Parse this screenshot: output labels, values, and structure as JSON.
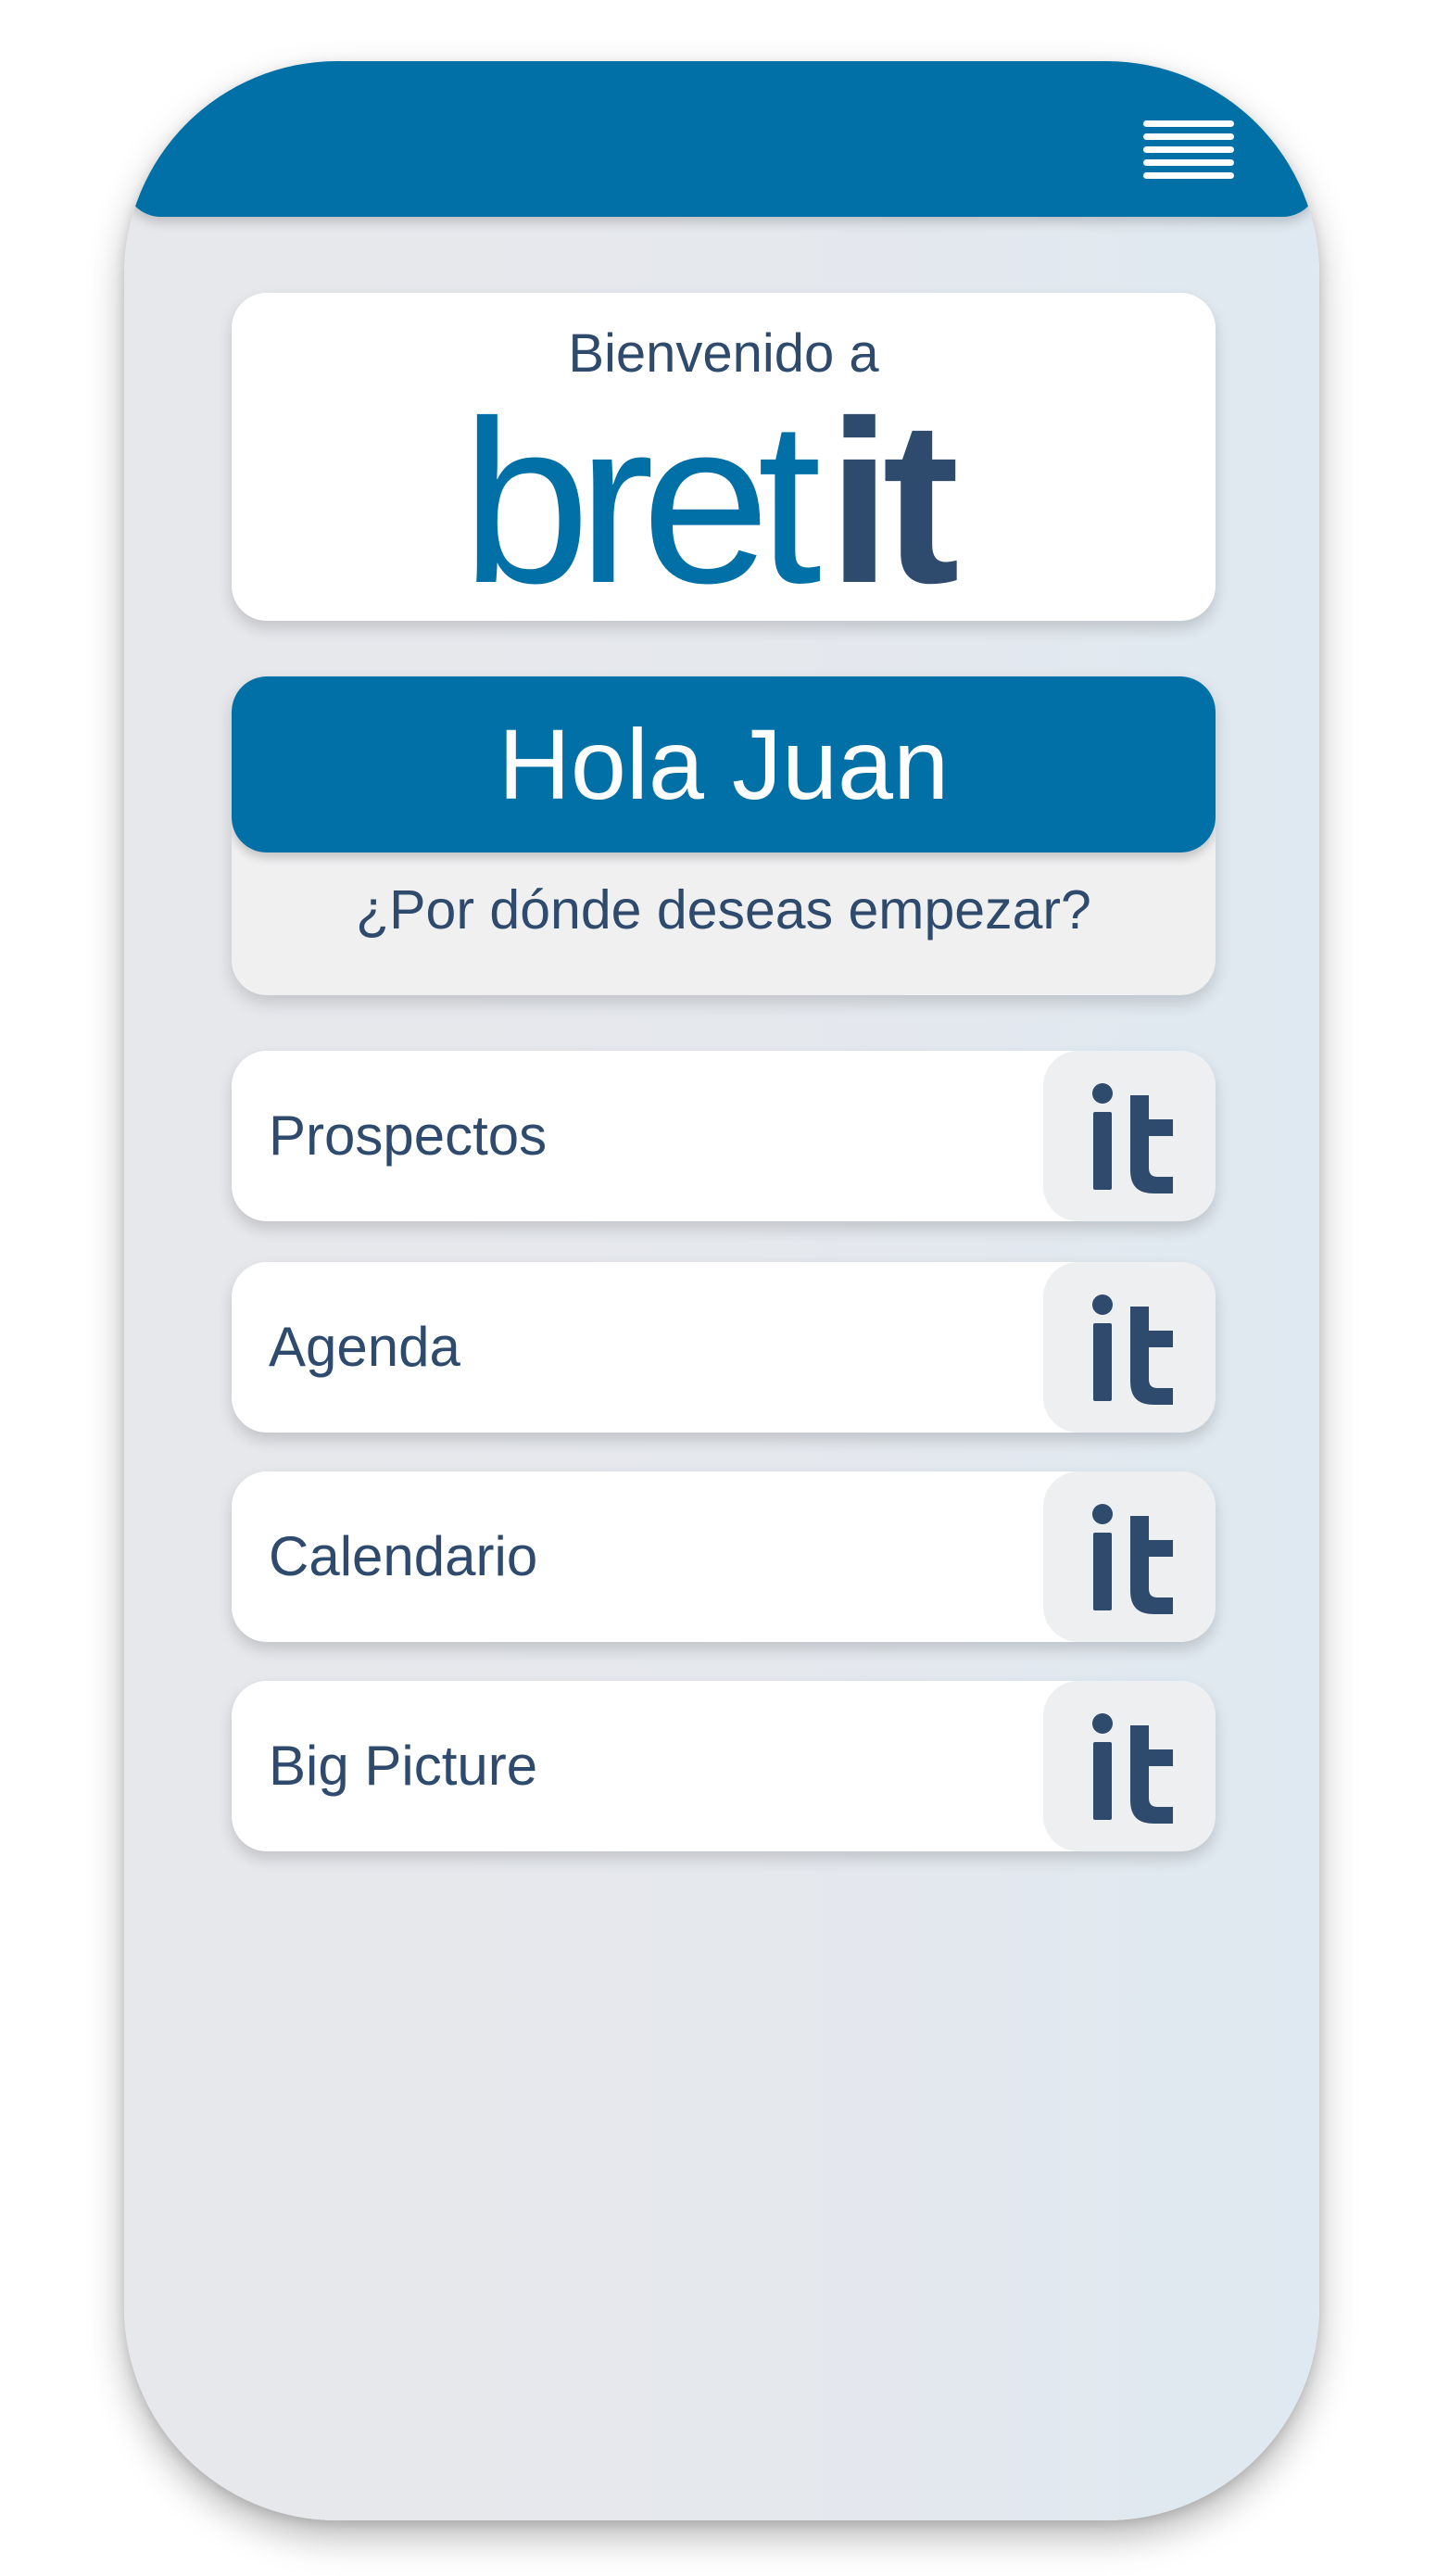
{
  "header": {
    "menu_icon": "hamburger-menu-icon",
    "color": "#0070a6"
  },
  "welcome": {
    "text": "Bienvenido a",
    "logo_text": "bretit",
    "logo_colors": {
      "primary": "#0070a6",
      "secondary": "#2e4a6d"
    }
  },
  "greeting": {
    "title": "Hola Juan",
    "subtitle": "¿Por dónde deseas empezar?"
  },
  "menu": {
    "items": [
      {
        "label": "Prospectos",
        "icon": "it-logo-icon"
      },
      {
        "label": "Agenda",
        "icon": "it-logo-icon"
      },
      {
        "label": "Calendario",
        "icon": "it-logo-icon"
      },
      {
        "label": "Big Picture",
        "icon": "it-logo-icon"
      }
    ]
  }
}
